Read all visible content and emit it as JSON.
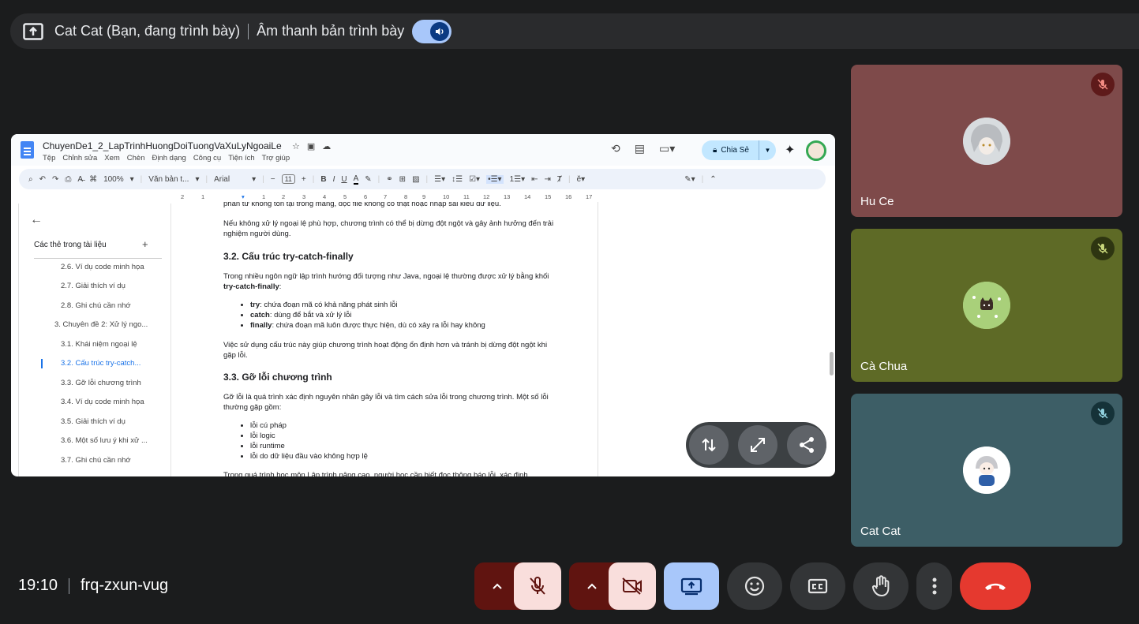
{
  "presentation_bar": {
    "title": "Cat Cat (Bạn, đang trình bày)",
    "audio_label": "Âm thanh bản trình bày"
  },
  "doc": {
    "filename": "ChuyenDe1_2_LapTrinhHuongDoiTuongVaXuLyNgoaiLe",
    "menus": [
      "Tệp",
      "Chỉnh sửa",
      "Xem",
      "Chèn",
      "Định dạng",
      "Công cụ",
      "Tiện ích",
      "Trợ giúp"
    ],
    "share_label": "Chia Sẻ",
    "toolbar": {
      "zoom": "100%",
      "style": "Văn bản t...",
      "font": "Arial",
      "font_size": "11"
    },
    "ruler": [
      "2",
      "1",
      "1",
      "2",
      "3",
      "4",
      "5",
      "6",
      "7",
      "8",
      "9",
      "10",
      "11",
      "12",
      "13",
      "14",
      "15",
      "16",
      "17",
      "18"
    ],
    "outline": {
      "title": "Các thẻ trong tài liệu",
      "items": [
        "2.6. Ví dụ code minh họa",
        "2.7. Giải thích ví dụ",
        "2.8. Ghi chú cần nhớ",
        "3. Chuyên đề 2: Xử lý ngo...",
        "3.1. Khái niệm ngoại lệ",
        "3.2. Cấu trúc try-catch...",
        "3.3. Gỡ lỗi chương trình",
        "3.4. Ví dụ code minh họa",
        "3.5. Giải thích ví dụ",
        "3.6. Một số lưu ý khi xử ...",
        "3.7. Ghi chú cần nhớ"
      ],
      "active_index": 5
    },
    "page": {
      "p0": "phần tử không tồn tại trong mảng, đọc file không có thật hoặc nhập sai kiểu dữ liệu.",
      "p1": "Nếu không xử lý ngoại lệ phù hợp, chương trình có thể bị dừng đột ngột và gây ảnh hưởng đến trải nghiệm người dùng.",
      "h1": "3.2. Cấu trúc try-catch-finally",
      "p2_a": "Trong nhiều ngôn ngữ lập trình hướng đối tượng như Java, ngoại lệ thường được xử lý bằng khối ",
      "p2_b": "try-catch-finally",
      "p2_c": ":",
      "bullets1": [
        {
          "k": "try",
          "v": ": chứa đoạn mã có khả năng phát sinh lỗi"
        },
        {
          "k": "catch",
          "v": ": dùng để bắt và xử lý lỗi"
        },
        {
          "k": "finally",
          "v": ": chứa đoạn mã luôn được thực hiện, dù có xảy ra lỗi hay không"
        }
      ],
      "p3": "Việc sử dụng cấu trúc này giúp chương trình hoạt động ổn định hơn và tránh bị dừng đột ngột khi gặp lỗi.",
      "h2": "3.3. Gỡ lỗi chương trình",
      "p4": "Gỡ lỗi là quá trình xác định nguyên nhân gây lỗi và tìm cách sửa lỗi trong chương trình. Một số lỗi thường gặp gồm:",
      "bullets2": [
        "lỗi cú pháp",
        "lỗi logic",
        "lỗi runtime",
        "lỗi do dữ liệu đầu vào không hợp lệ"
      ],
      "p5": "Trong quá trình học môn Lập trình nâng cao, người học cần biết đọc thông báo lỗi, xác định"
    }
  },
  "participants": [
    {
      "name": "Hu Ce",
      "bg": "#7e4a4a"
    },
    {
      "name": "Cà Chua",
      "bg": "#5e6a26"
    },
    {
      "name": "Cat Cat",
      "bg": "#3d5e66"
    }
  ],
  "bottom": {
    "time": "19:10",
    "meeting_code": "frq-zxun-vug"
  },
  "colors": {
    "leave_button": "#e5392f",
    "muted_bg": "#f9dedc",
    "muted_side": "#601410",
    "present_active": "#a8c7fa"
  }
}
